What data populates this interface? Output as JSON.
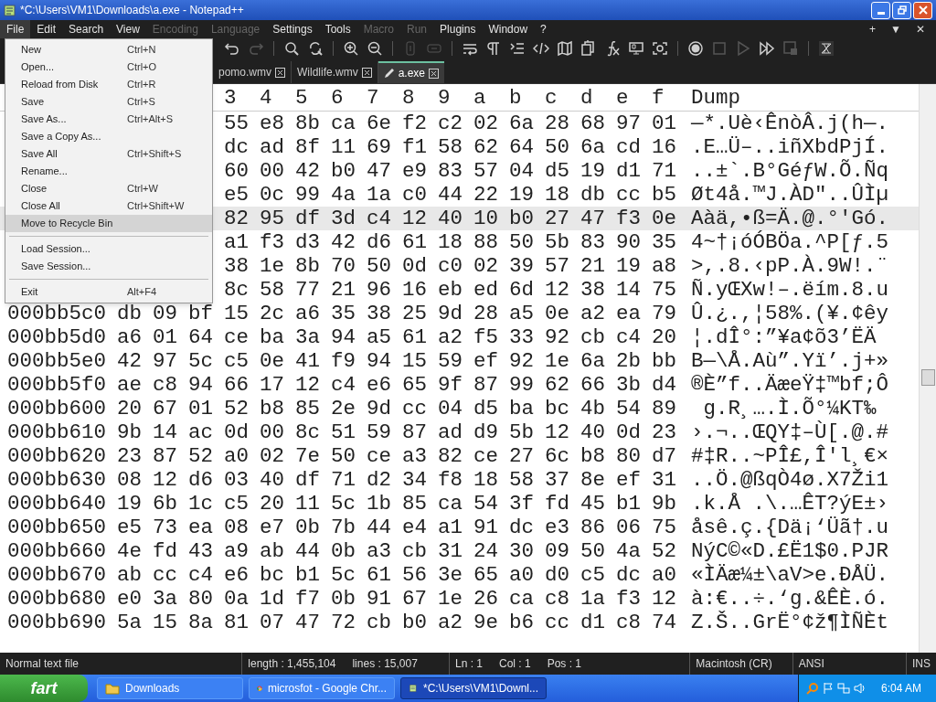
{
  "window": {
    "title": "*C:\\Users\\VM1\\Downloads\\a.exe - Notepad++"
  },
  "menu_bar": [
    {
      "label": "File",
      "selected": true,
      "disabled": false
    },
    {
      "label": "Edit",
      "selected": false,
      "disabled": false
    },
    {
      "label": "Search",
      "selected": false,
      "disabled": false
    },
    {
      "label": "View",
      "selected": false,
      "disabled": false
    },
    {
      "label": "Encoding",
      "selected": false,
      "disabled": true
    },
    {
      "label": "Language",
      "selected": false,
      "disabled": true
    },
    {
      "label": "Settings",
      "selected": false,
      "disabled": false
    },
    {
      "label": "Tools",
      "selected": false,
      "disabled": false
    },
    {
      "label": "Macro",
      "selected": false,
      "disabled": true
    },
    {
      "label": "Run",
      "selected": false,
      "disabled": true
    },
    {
      "label": "Plugins",
      "selected": false,
      "disabled": false
    },
    {
      "label": "Window",
      "selected": false,
      "disabled": false
    },
    {
      "label": "?",
      "selected": false,
      "disabled": false
    }
  ],
  "menu_bar_right": [
    "+",
    "▼",
    "✕"
  ],
  "toolbar": [
    {
      "kind": "undo",
      "disabled": false
    },
    {
      "kind": "redo",
      "disabled": true
    },
    {
      "kind": "sep"
    },
    {
      "kind": "find",
      "disabled": false
    },
    {
      "kind": "replace",
      "disabled": false
    },
    {
      "kind": "sep"
    },
    {
      "kind": "zoomin",
      "disabled": false
    },
    {
      "kind": "zoomout",
      "disabled": false
    },
    {
      "kind": "sep"
    },
    {
      "kind": "syncv",
      "disabled": true
    },
    {
      "kind": "synch",
      "disabled": true
    },
    {
      "kind": "sep"
    },
    {
      "kind": "wrap",
      "disabled": false
    },
    {
      "kind": "pilcrow",
      "disabled": false
    },
    {
      "kind": "indent",
      "disabled": false
    },
    {
      "kind": "tag",
      "disabled": false
    },
    {
      "kind": "map",
      "disabled": false
    },
    {
      "kind": "docs",
      "disabled": false
    },
    {
      "kind": "fx",
      "disabled": false
    },
    {
      "kind": "monitor",
      "disabled": false
    },
    {
      "kind": "camera",
      "disabled": false
    },
    {
      "kind": "sep"
    },
    {
      "kind": "record",
      "disabled": false
    },
    {
      "kind": "stop",
      "disabled": true
    },
    {
      "kind": "play",
      "disabled": true
    },
    {
      "kind": "playmany",
      "disabled": false
    },
    {
      "kind": "savemacro",
      "disabled": true
    },
    {
      "kind": "sep"
    },
    {
      "kind": "hex",
      "disabled": false
    }
  ],
  "tabs": [
    {
      "label": "pomo.wmv",
      "selected": false,
      "modified": false
    },
    {
      "label": "Wildlife.wmv",
      "selected": false,
      "modified": false
    },
    {
      "label": "a.exe",
      "selected": true,
      "modified": true
    }
  ],
  "file_menu": [
    {
      "kind": "item",
      "label": "New",
      "shortcut": "Ctrl+N",
      "selected": false
    },
    {
      "kind": "item",
      "label": "Open...",
      "shortcut": "Ctrl+O",
      "selected": false
    },
    {
      "kind": "item",
      "label": "Reload from Disk",
      "shortcut": "Ctrl+R",
      "selected": false
    },
    {
      "kind": "item",
      "label": "Save",
      "shortcut": "Ctrl+S",
      "selected": false
    },
    {
      "kind": "item",
      "label": "Save As...",
      "shortcut": "Ctrl+Alt+S",
      "selected": false
    },
    {
      "kind": "item",
      "label": "Save a Copy As...",
      "selected": false
    },
    {
      "kind": "item",
      "label": "Save All",
      "shortcut": "Ctrl+Shift+S",
      "selected": false
    },
    {
      "kind": "item",
      "label": "Rename...",
      "selected": false
    },
    {
      "kind": "item",
      "label": "Close",
      "shortcut": "Ctrl+W",
      "selected": false
    },
    {
      "kind": "item",
      "label": "Close All",
      "shortcut": "Ctrl+Shift+W",
      "selected": false
    },
    {
      "kind": "item",
      "label": "Move to Recycle Bin",
      "selected": true
    },
    {
      "kind": "separator"
    },
    {
      "kind": "item",
      "label": "Load Session...",
      "selected": false
    },
    {
      "kind": "item",
      "label": "Save Session...",
      "selected": false
    },
    {
      "kind": "separator"
    },
    {
      "kind": "item",
      "label": "Exit",
      "shortcut": "Alt+F4",
      "selected": false
    }
  ],
  "hex_view": {
    "columns": [
      "3",
      "4",
      "5",
      "6",
      "7",
      "8",
      "9",
      "a",
      "b",
      "c",
      "d",
      "e",
      "f",
      "Dump"
    ],
    "rows": [
      {
        "current": false,
        "bytes": [
          "55",
          "e8",
          "8b",
          "ca",
          "6e",
          "f2",
          "c2",
          "02",
          "6a",
          "28",
          "68",
          "97",
          "01"
        ],
        "dump": "—*.Uè‹ÊnòÂ.j(h—."
      },
      {
        "current": false,
        "bytes": [
          "dc",
          "ad",
          "8f",
          "11",
          "69",
          "f1",
          "58",
          "62",
          "64",
          "50",
          "6a",
          "cd",
          "16"
        ],
        "dump": ".E…Ü–..iñXbdPjÍ."
      },
      {
        "current": false,
        "bytes": [
          "60",
          "00",
          "42",
          "b0",
          "47",
          "e9",
          "83",
          "57",
          "04",
          "d5",
          "19",
          "d1",
          "71"
        ],
        "dump": "..±`.B°GéƒW.Õ.Ñq"
      },
      {
        "current": false,
        "bytes": [
          "e5",
          "0c",
          "99",
          "4a",
          "1a",
          "c0",
          "44",
          "22",
          "19",
          "18",
          "db",
          "cc",
          "b5"
        ],
        "dump": "Øt4å.™J.ÀD\"..ÛÌµ"
      },
      {
        "current": true,
        "bytes": [
          "82",
          "95",
          "df",
          "3d",
          "c4",
          "12",
          "40",
          "10",
          "b0",
          "27",
          "47",
          "f3",
          "0e"
        ],
        "dump": "Aàä,•ß=Ä.@.°'Gó."
      },
      {
        "current": false,
        "bytes": [
          "a1",
          "f3",
          "d3",
          "42",
          "d6",
          "61",
          "18",
          "88",
          "50",
          "5b",
          "83",
          "90",
          "35"
        ],
        "dump": "4~†¡óÓBÖa.^P[ƒ.5"
      },
      {
        "current": false,
        "bytes": [
          "38",
          "1e",
          "8b",
          "70",
          "50",
          "0d",
          "c0",
          "02",
          "39",
          "57",
          "21",
          "19",
          "a8"
        ],
        "dump": ">,.8.‹pP.À.9W!.¨"
      },
      {
        "current": false,
        "bytes": [
          "8c",
          "58",
          "77",
          "21",
          "96",
          "16",
          "eb",
          "ed",
          "6d",
          "12",
          "38",
          "14",
          "75"
        ],
        "dump": "Ñ.yŒXw!–.ëím.8.u"
      },
      {
        "current": false,
        "address": "000bb5c0",
        "bytes": [
          "db",
          "09",
          "bf",
          "15",
          "2c",
          "a6",
          "35",
          "38",
          "25",
          "9d",
          "28",
          "a5",
          "0e",
          "a2",
          "ea",
          "79"
        ],
        "dump": "Û.¿.,¦58%.(¥.¢êy"
      },
      {
        "current": false,
        "address": "000bb5d0",
        "bytes": [
          "a6",
          "01",
          "64",
          "ce",
          "ba",
          "3a",
          "94",
          "a5",
          "61",
          "a2",
          "f5",
          "33",
          "92",
          "cb",
          "c4",
          "20"
        ],
        "dump": "¦.dÎ°:”¥a¢õ3’ËÄ"
      },
      {
        "current": false,
        "address": "000bb5e0",
        "bytes": [
          "42",
          "97",
          "5c",
          "c5",
          "0e",
          "41",
          "f9",
          "94",
          "15",
          "59",
          "ef",
          "92",
          "1e",
          "6a",
          "2b",
          "bb"
        ],
        "dump": "B—\\Å.Aù”.Yï’.j+»"
      },
      {
        "current": false,
        "address": "000bb5f0",
        "bytes": [
          "ae",
          "c8",
          "94",
          "66",
          "17",
          "12",
          "c4",
          "e6",
          "65",
          "9f",
          "87",
          "99",
          "62",
          "66",
          "3b",
          "d4"
        ],
        "dump": "®È”f..ÄæeŸ‡™bf;Ô"
      },
      {
        "current": false,
        "address": "000bb600",
        "bytes": [
          "20",
          "67",
          "01",
          "52",
          "b8",
          "85",
          "2e",
          "9d",
          "cc",
          "04",
          "d5",
          "ba",
          "bc",
          "4b",
          "54",
          "89"
        ],
        "dump": " g.R¸….Ì.Õ°¼KT‰"
      },
      {
        "current": false,
        "address": "000bb610",
        "bytes": [
          "9b",
          "14",
          "ac",
          "0d",
          "00",
          "8c",
          "51",
          "59",
          "87",
          "ad",
          "d9",
          "5b",
          "12",
          "40",
          "0d",
          "23"
        ],
        "dump": "›.¬..ŒQY‡–Ù[.@.#"
      },
      {
        "current": false,
        "address": "000bb620",
        "bytes": [
          "23",
          "87",
          "52",
          "a0",
          "02",
          "7e",
          "50",
          "ce",
          "a3",
          "82",
          "ce",
          "27",
          "6c",
          "b8",
          "80",
          "d7"
        ],
        "dump": "#‡R..~PÎ£,Î'l¸€×"
      },
      {
        "current": false,
        "address": "000bb630",
        "bytes": [
          "08",
          "12",
          "d6",
          "03",
          "40",
          "df",
          "71",
          "d2",
          "34",
          "f8",
          "18",
          "58",
          "37",
          "8e",
          "ef",
          "31"
        ],
        "dump": "..Ö.@ßqÒ4ø.X7Ži1"
      },
      {
        "current": false,
        "address": "000bb640",
        "bytes": [
          "19",
          "6b",
          "1c",
          "c5",
          "20",
          "11",
          "5c",
          "1b",
          "85",
          "ca",
          "54",
          "3f",
          "fd",
          "45",
          "b1",
          "9b"
        ],
        "dump": ".k.Å .\\.…ÊT?ýE±›"
      },
      {
        "current": false,
        "address": "000bb650",
        "bytes": [
          "e5",
          "73",
          "ea",
          "08",
          "e7",
          "0b",
          "7b",
          "44",
          "e4",
          "a1",
          "91",
          "dc",
          "e3",
          "86",
          "06",
          "75"
        ],
        "dump": "åsê.ç.{Dä¡‘Üã†.u"
      },
      {
        "current": false,
        "address": "000bb660",
        "bytes": [
          "4e",
          "fd",
          "43",
          "a9",
          "ab",
          "44",
          "0b",
          "a3",
          "cb",
          "31",
          "24",
          "30",
          "09",
          "50",
          "4a",
          "52"
        ],
        "dump": "NýC©«D.£Ë1$0.PJR"
      },
      {
        "current": false,
        "address": "000bb670",
        "bytes": [
          "ab",
          "cc",
          "c4",
          "e6",
          "bc",
          "b1",
          "5c",
          "61",
          "56",
          "3e",
          "65",
          "a0",
          "d0",
          "c5",
          "dc",
          "a0"
        ],
        "dump": "«ÌÄæ¼±\\aV>e.ÐÅÜ."
      },
      {
        "current": false,
        "address": "000bb680",
        "bytes": [
          "e0",
          "3a",
          "80",
          "0a",
          "1d",
          "f7",
          "0b",
          "91",
          "67",
          "1e",
          "26",
          "ca",
          "c8",
          "1a",
          "f3",
          "12"
        ],
        "dump": "à:€..÷.‘g.&ÊÈ.ó."
      },
      {
        "current": false,
        "address": "000bb690",
        "bytes": [
          "5a",
          "15",
          "8a",
          "81",
          "07",
          "47",
          "72",
          "cb",
          "b0",
          "a2",
          "9e",
          "b6",
          "cc",
          "d1",
          "c8",
          "74"
        ],
        "dump": "Z.Š..GrË°¢ž¶ÌÑÈt"
      }
    ]
  },
  "status_bar": {
    "file_type": "Normal text file",
    "length": "length : 1,455,104",
    "lines": "lines : 15,007",
    "ln": "Ln : 1",
    "col": "Col : 1",
    "pos": "Pos : 1",
    "eol": "Macintosh (CR)",
    "encoding": "ANSI",
    "mode": "INS"
  },
  "taskbar": {
    "start": "fart",
    "tasks": [
      {
        "label": "Downloads",
        "kind": "folder",
        "selected": false
      },
      {
        "label": "microsfot - Google Chr...",
        "kind": "browser",
        "selected": false
      },
      {
        "label": "*C:\\Users\\VM1\\Downl...",
        "kind": "notepad",
        "selected": true
      }
    ],
    "clock": "6:04 AM"
  }
}
